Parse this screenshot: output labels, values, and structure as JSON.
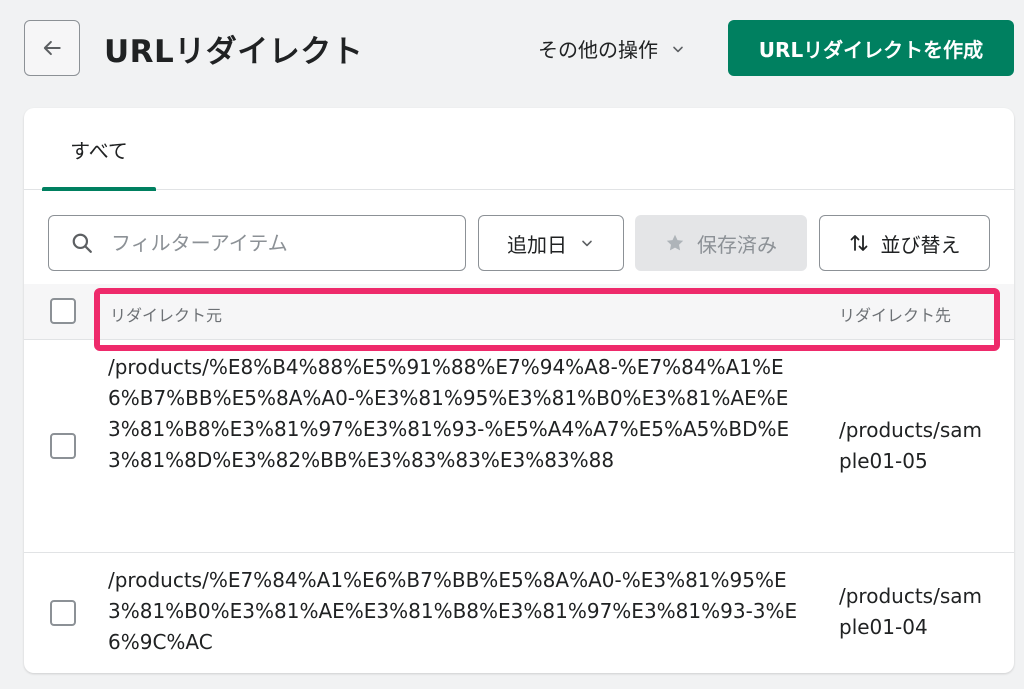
{
  "header": {
    "title": "URLリダイレクト",
    "more_actions_label": "その他の操作",
    "create_button_label": "URLリダイレクトを作成"
  },
  "tabs": [
    {
      "label": "すべて",
      "selected": true
    }
  ],
  "filters": {
    "search_placeholder": "フィルターアイテム",
    "date_added_label": "追加日",
    "saved_label": "保存済み",
    "sort_label": "並び替え"
  },
  "table": {
    "columns": [
      "リダイレクト元",
      "リダイレクト先"
    ],
    "rows": [
      {
        "source": "/products/%E8%B4%88%E5%91%88%E7%94%A8-%E7%84%A1%E6%B7%BB%E5%8A%A0-%E3%81%95%E3%81%B0%E3%81%AE%E3%81%B8%E3%81%97%E3%81%93-%E5%A4%A7%E5%A5%BD%E3%81%8D%E3%82%BB%E3%83%83%E3%83%88",
        "target": "/products/sample01-05"
      },
      {
        "source": "/products/%E7%84%A1%E6%B7%BB%E5%8A%A0-%E3%81%95%E3%81%B0%E3%81%AE%E3%81%B8%E3%81%97%E3%81%93-3%E6%9C%AC",
        "target": "/products/sample01-04"
      }
    ]
  },
  "colors": {
    "primary": "#008060",
    "highlight": "#ee2a6b",
    "background": "#f1f2f3"
  }
}
